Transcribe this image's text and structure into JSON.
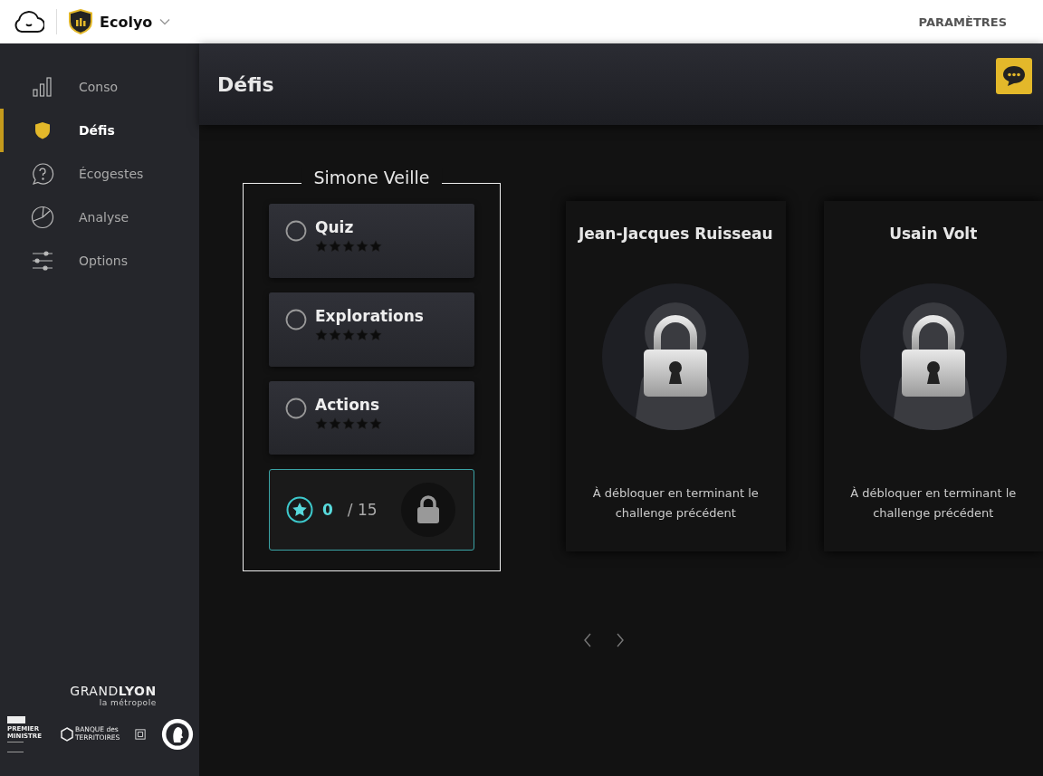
{
  "topbar": {
    "app_name": "Ecolyo",
    "settings_link": "PARAMÈTRES"
  },
  "sidebar": {
    "items": [
      {
        "label": "Conso",
        "selected": false
      },
      {
        "label": "Défis",
        "selected": true
      },
      {
        "label": "Écogestes",
        "selected": false
      },
      {
        "label": "Analyse",
        "selected": false
      },
      {
        "label": "Options",
        "selected": false
      }
    ],
    "partners": {
      "grandlyon": [
        "GRAND",
        "LYON"
      ],
      "grandlyon_sub": "la métropole",
      "premier_ministre": "PREMIER MINISTRE",
      "banque": "BANQUE des TERRITOIRES"
    }
  },
  "header": {
    "title": "Défis"
  },
  "challenges": [
    {
      "kind": "active",
      "title": "Simone Veille",
      "steps": [
        {
          "label": "Quiz",
          "done": false,
          "stars": 0
        },
        {
          "label": "Explorations",
          "done": false,
          "stars": 0
        },
        {
          "label": "Actions",
          "done": false,
          "stars": 0
        }
      ],
      "score": {
        "earned": "0",
        "total": "/ 15"
      }
    },
    {
      "kind": "locked",
      "title": "Jean-Jacques Ruisseau",
      "message": "À débloquer en terminant le challenge précédent"
    },
    {
      "kind": "locked",
      "title": "Usain Volt",
      "message": "À débloquer en terminant le challenge précédent"
    }
  ]
}
